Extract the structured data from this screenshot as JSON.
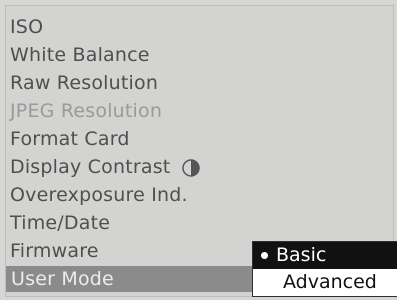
{
  "menu": {
    "items": [
      {
        "label": "ISO",
        "state": "normal"
      },
      {
        "label": "White Balance",
        "state": "normal"
      },
      {
        "label": "Raw Resolution",
        "state": "normal"
      },
      {
        "label": "JPEG Resolution",
        "state": "disabled"
      },
      {
        "label": "Format Card",
        "state": "normal"
      },
      {
        "label": "Display Contrast",
        "state": "normal",
        "icon": "contrast-icon"
      },
      {
        "label": "Overexposure Ind.",
        "state": "normal"
      },
      {
        "label": "Time/Date",
        "state": "normal"
      },
      {
        "label": "Firmware",
        "state": "normal"
      },
      {
        "label": "User Mode",
        "state": "selected"
      }
    ]
  },
  "submenu": {
    "items": [
      {
        "label": "Basic",
        "selected": true
      },
      {
        "label": "Advanced",
        "selected": false
      }
    ]
  },
  "colors": {
    "background": "#d3d3d1",
    "text": "#4f4f4f",
    "disabled_text": "#9a9a9a",
    "selected_bg": "#8b8b8b",
    "submenu_active_bg": "#111111"
  }
}
